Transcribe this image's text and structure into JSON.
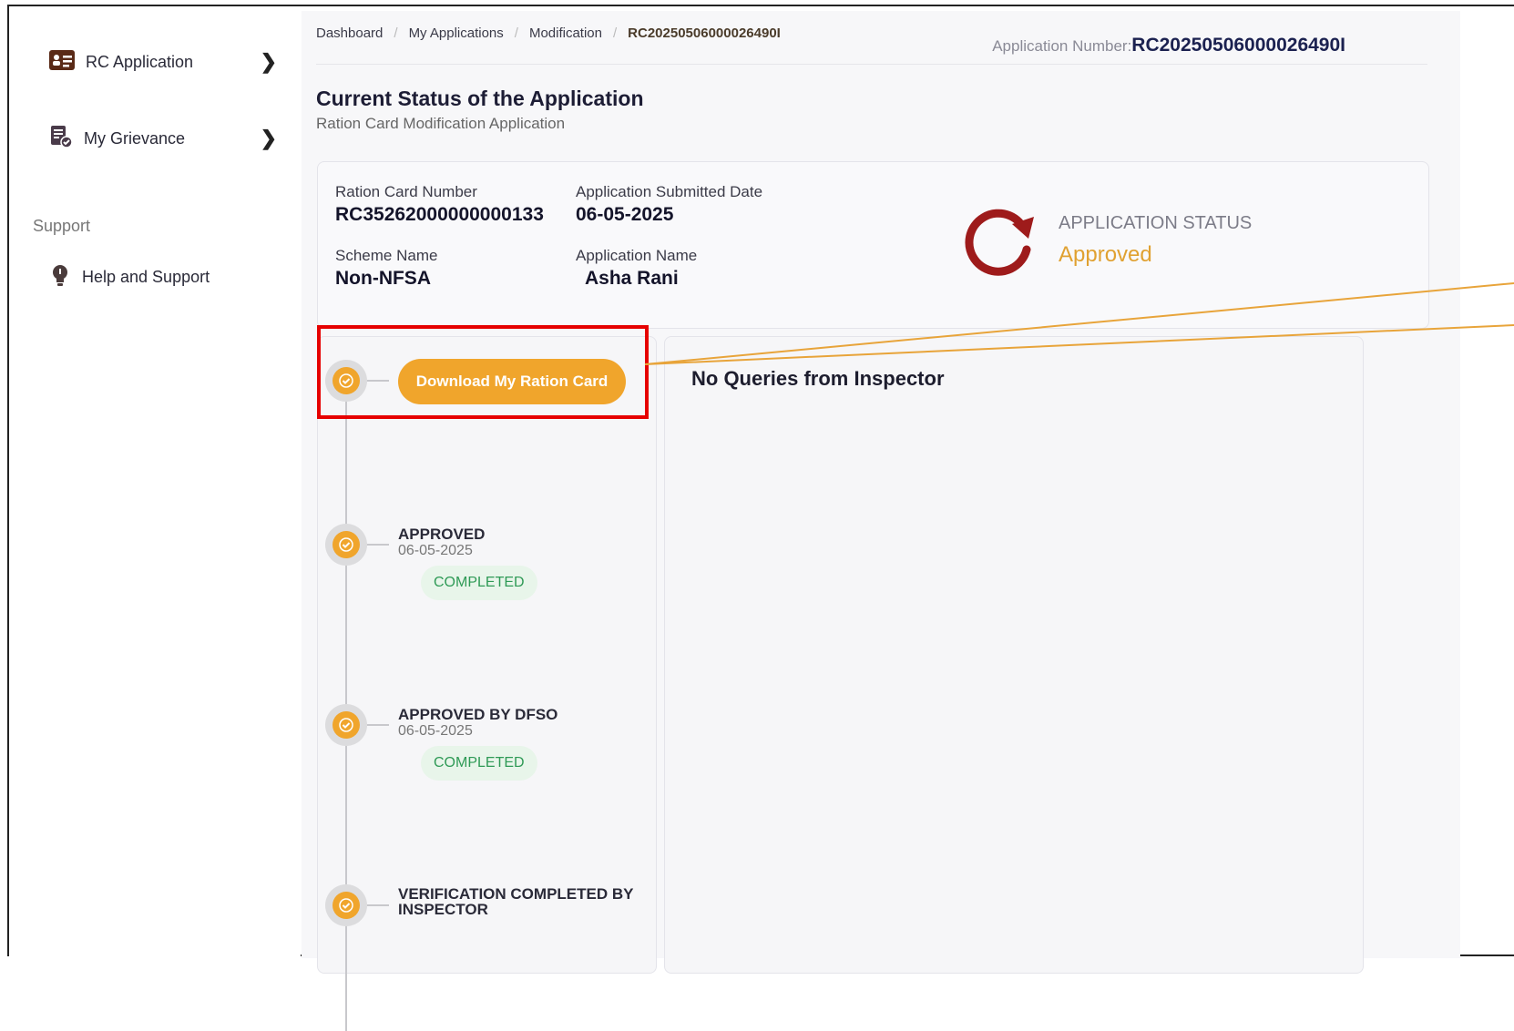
{
  "sidebar": {
    "items": [
      {
        "label": "RC Application",
        "icon": "id-card-icon"
      },
      {
        "label": "My Grievance",
        "icon": "document-check-icon"
      }
    ],
    "support_heading": "Support",
    "support_items": [
      {
        "label": "Help and Support",
        "icon": "lightbulb-icon"
      }
    ]
  },
  "breadcrumb": [
    "Dashboard",
    "My Applications",
    "Modification",
    "RC20250506000026490I"
  ],
  "header": {
    "app_number_label": "Application Number:",
    "app_number_value": "RC20250506000026490I",
    "title": "Current Status of the Application",
    "subtitle": "Ration Card Modification Application"
  },
  "info": {
    "ration_card_label": "Ration Card Number",
    "ration_card_value": "RC35262000000000133",
    "submitted_label": "Application Submitted Date",
    "submitted_value": "06-05-2025",
    "scheme_label": "Scheme Name",
    "scheme_value": "Non-NFSA",
    "app_name_label": "Application Name",
    "app_name_value": "Asha Rani",
    "status_label": "APPLICATION STATUS",
    "status_value": "Approved"
  },
  "timeline": {
    "download_label": "Download My Ration Card",
    "steps": [
      {
        "title": "APPROVED",
        "date": "06-05-2025",
        "badge": "COMPLETED"
      },
      {
        "title": "APPROVED BY DFSO",
        "date": "06-05-2025",
        "badge": "COMPLETED"
      },
      {
        "title": "VERIFICATION COMPLETED BY INSPECTOR",
        "date": "",
        "badge": ""
      }
    ]
  },
  "queries": {
    "title": "No Queries from Inspector"
  },
  "colors": {
    "accent": "#f0a52c",
    "status_icon": "#9e1b1b",
    "highlight": "#e60000",
    "completed_text": "#2f9a56"
  }
}
